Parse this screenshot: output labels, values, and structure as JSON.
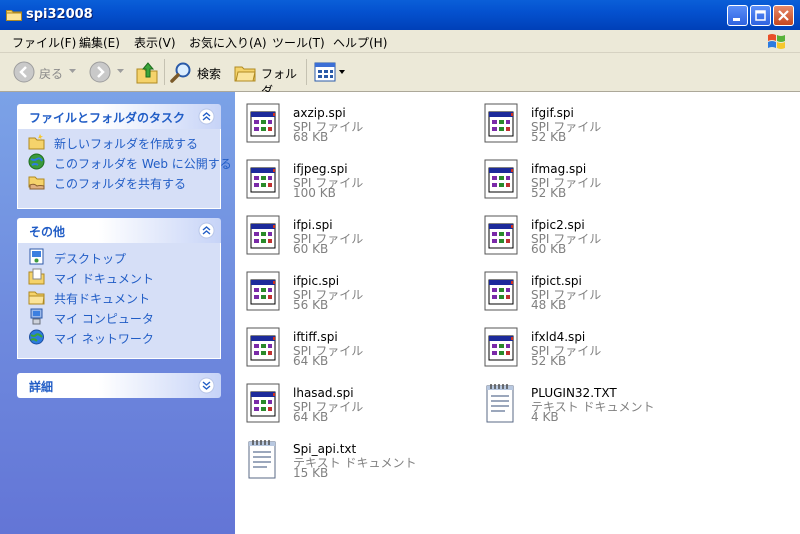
{
  "window": {
    "title": "spi32008"
  },
  "menubar": {
    "items": [
      {
        "label": "ファイル(F)"
      },
      {
        "label": "編集(E)"
      },
      {
        "label": "表示(V)"
      },
      {
        "label": "お気に入り(A)"
      },
      {
        "label": "ツール(T)"
      },
      {
        "label": "ヘルプ(H)"
      }
    ]
  },
  "toolbar": {
    "back_label": "戻る",
    "search_label": "検索",
    "folders_label": "フォルダ"
  },
  "taskpane": {
    "file_tasks": {
      "title": "ファイルとフォルダのタスク",
      "items": [
        {
          "label": "新しいフォルダを作成する",
          "icon": "new-folder-icon"
        },
        {
          "label": "このフォルダを Web に公開する",
          "icon": "web-publish-icon"
        },
        {
          "label": "このフォルダを共有する",
          "icon": "share-folder-icon"
        }
      ]
    },
    "other_places": {
      "title": "その他",
      "items": [
        {
          "label": "デスクトップ",
          "icon": "desktop-icon"
        },
        {
          "label": "マイ ドキュメント",
          "icon": "my-documents-icon"
        },
        {
          "label": "共有ドキュメント",
          "icon": "shared-documents-icon"
        },
        {
          "label": "マイ コンピュータ",
          "icon": "my-computer-icon"
        },
        {
          "label": "マイ ネットワーク",
          "icon": "my-network-icon"
        }
      ]
    },
    "details": {
      "title": "詳細"
    }
  },
  "files": [
    {
      "name": "axzip.spi",
      "type": "SPI ファイル",
      "size": "68 KB",
      "kind": "spi"
    },
    {
      "name": "ifgif.spi",
      "type": "SPI ファイル",
      "size": "52 KB",
      "kind": "spi"
    },
    {
      "name": "ifjpeg.spi",
      "type": "SPI ファイル",
      "size": "100 KB",
      "kind": "spi"
    },
    {
      "name": "ifmag.spi",
      "type": "SPI ファイル",
      "size": "52 KB",
      "kind": "spi"
    },
    {
      "name": "ifpi.spi",
      "type": "SPI ファイル",
      "size": "60 KB",
      "kind": "spi"
    },
    {
      "name": "ifpic2.spi",
      "type": "SPI ファイル",
      "size": "60 KB",
      "kind": "spi"
    },
    {
      "name": "ifpic.spi",
      "type": "SPI ファイル",
      "size": "56 KB",
      "kind": "spi"
    },
    {
      "name": "ifpict.spi",
      "type": "SPI ファイル",
      "size": "48 KB",
      "kind": "spi"
    },
    {
      "name": "iftiff.spi",
      "type": "SPI ファイル",
      "size": "64 KB",
      "kind": "spi"
    },
    {
      "name": "ifxld4.spi",
      "type": "SPI ファイル",
      "size": "52 KB",
      "kind": "spi"
    },
    {
      "name": "lhasad.spi",
      "type": "SPI ファイル",
      "size": "64 KB",
      "kind": "spi"
    },
    {
      "name": "PLUGIN32.TXT",
      "type": "テキスト ドキュメント",
      "size": "4 KB",
      "kind": "txt"
    },
    {
      "name": "Spi_api.txt",
      "type": "テキスト ドキュメント",
      "size": "15 KB",
      "kind": "txt"
    }
  ],
  "colors": {
    "titlebar": "#0451cf",
    "taskpane_bg": "#6f8ee0",
    "task_link": "#215dc6",
    "meta_text": "#808080"
  }
}
